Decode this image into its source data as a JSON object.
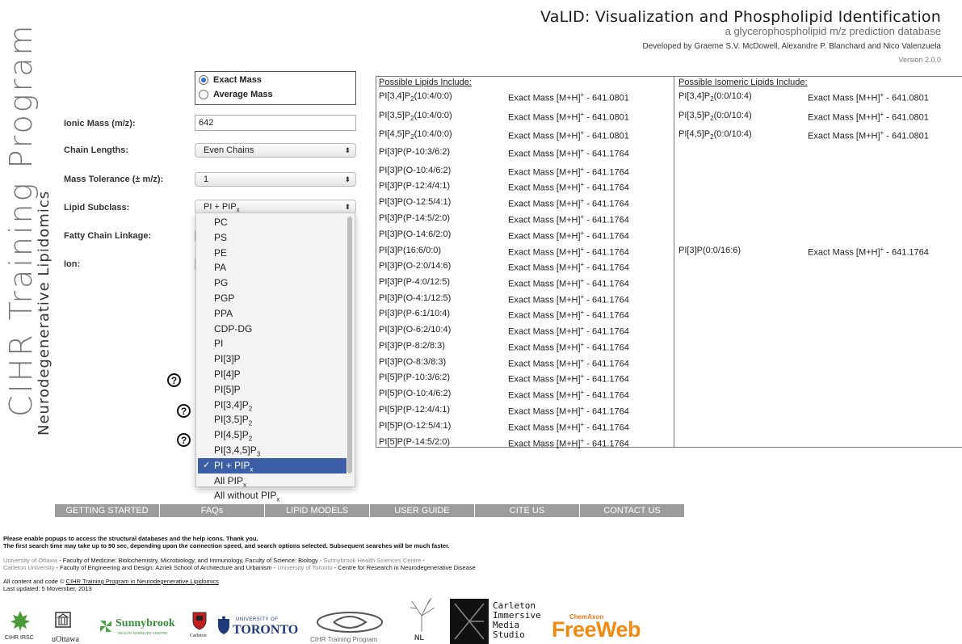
{
  "header": {
    "title": "VaLID: Visualization and Phospholipid Identification",
    "subtitle": "a glycerophospholipid m/z prediction database",
    "developers": "Developed by Graeme S.V. McDowell, Alexandre P. Blanchard and Nico Valenzuela",
    "version": "Version 2.0.0"
  },
  "branding": {
    "program": "CIHR Training Program",
    "field": "Neurodegenerative Lipidomics"
  },
  "form": {
    "mass_type": {
      "exact": "Exact Mass",
      "average": "Average Mass",
      "selected": "exact"
    },
    "ionic_mass_label": "Ionic Mass (m/z):",
    "ionic_mass_value": "642",
    "chain_lengths_label": "Chain Lengths:",
    "chain_lengths_value": "Even Chains",
    "tolerance_label": "Mass Tolerance (± m/z):",
    "tolerance_value": "1",
    "subclass_label": "Lipid Subclass:",
    "subclass_value_base": "PI + PIP",
    "subclass_value_sub": "x",
    "linkage_label": "Fatty Chain Linkage:",
    "ion_label": "Ion:"
  },
  "dropdown": {
    "options": [
      {
        "text": "PC",
        "sub": ""
      },
      {
        "text": "PS",
        "sub": ""
      },
      {
        "text": "PE",
        "sub": ""
      },
      {
        "text": "PA",
        "sub": ""
      },
      {
        "text": "PG",
        "sub": ""
      },
      {
        "text": "PGP",
        "sub": ""
      },
      {
        "text": "PPA",
        "sub": ""
      },
      {
        "text": "CDP-DG",
        "sub": ""
      },
      {
        "text": "PI",
        "sub": ""
      },
      {
        "text": "PI[3]P",
        "sub": ""
      },
      {
        "text": "PI[4]P",
        "sub": ""
      },
      {
        "text": "PI[5]P",
        "sub": ""
      },
      {
        "text": "PI[3,4]P",
        "sub": "2"
      },
      {
        "text": "PI[3,5]P",
        "sub": "2"
      },
      {
        "text": "PI[4,5]P",
        "sub": "2"
      },
      {
        "text": "PI[3,4,5]P",
        "sub": "3"
      },
      {
        "text": "PI + PIP",
        "sub": "x"
      },
      {
        "text": "All PIP",
        "sub": "x"
      },
      {
        "text": "All without PIP",
        "sub": "x"
      }
    ],
    "selected_index": 16,
    "check": "✓"
  },
  "help_icon": "?",
  "results": {
    "heading": "Possible Lipids Include:",
    "mass_prefix": "Exact Mass [M+H]",
    "mass_sup": "+",
    "rows": [
      {
        "pre": "PI[3,4]P",
        "sub": "2",
        "post": "(10:4/0:0)",
        "mass": " - 641.0801"
      },
      {
        "pre": "PI[3,5]P",
        "sub": "2",
        "post": "(10:4/0:0)",
        "mass": " - 641.0801"
      },
      {
        "pre": "PI[4,5]P",
        "sub": "2",
        "post": "(10:4/0:0)",
        "mass": " - 641.0801"
      },
      {
        "pre": "PI[3]P(P-10:3/6:2)",
        "sub": "",
        "post": "",
        "mass": " - 641.1764"
      },
      {
        "pre": "PI[3]P(O-10:4/6:2)",
        "sub": "",
        "post": "",
        "mass": " - 641.1764"
      },
      {
        "pre": "PI[3]P(P-12:4/4:1)",
        "sub": "",
        "post": "",
        "mass": " - 641.1764"
      },
      {
        "pre": "PI[3]P(O-12:5/4:1)",
        "sub": "",
        "post": "",
        "mass": " - 641.1764"
      },
      {
        "pre": "PI[3]P(P-14:5/2:0)",
        "sub": "",
        "post": "",
        "mass": " - 641.1764"
      },
      {
        "pre": "PI[3]P(O-14:6/2:0)",
        "sub": "",
        "post": "",
        "mass": " - 641.1764"
      },
      {
        "pre": "PI[3]P(16:6/0:0)",
        "sub": "",
        "post": "",
        "mass": " - 641.1764"
      },
      {
        "pre": "PI[3]P(O-2:0/14:6)",
        "sub": "",
        "post": "",
        "mass": " - 641.1764"
      },
      {
        "pre": "PI[3]P(P-4:0/12:5)",
        "sub": "",
        "post": "",
        "mass": " - 641.1764"
      },
      {
        "pre": "PI[3]P(O-4:1/12:5)",
        "sub": "",
        "post": "",
        "mass": " - 641.1764"
      },
      {
        "pre": "PI[3]P(P-6:1/10:4)",
        "sub": "",
        "post": "",
        "mass": " - 641.1764"
      },
      {
        "pre": "PI[3]P(O-6:2/10:4)",
        "sub": "",
        "post": "",
        "mass": " - 641.1764"
      },
      {
        "pre": "PI[3]P(P-8:2/8:3)",
        "sub": "",
        "post": "",
        "mass": " - 641.1764"
      },
      {
        "pre": "PI[3]P(O-8:3/8:3)",
        "sub": "",
        "post": "",
        "mass": " - 641.1764"
      },
      {
        "pre": "PI[5]P(P-10:3/6:2)",
        "sub": "",
        "post": "",
        "mass": " - 641.1764"
      },
      {
        "pre": "PI[5]P(O-10:4/6:2)",
        "sub": "",
        "post": "",
        "mass": " - 641.1764"
      },
      {
        "pre": "PI[5]P(P-12:4/4:1)",
        "sub": "",
        "post": "",
        "mass": " - 641.1764"
      },
      {
        "pre": "PI[5]P(O-12:5/4:1)",
        "sub": "",
        "post": "",
        "mass": " - 641.1764"
      },
      {
        "pre": "PI[5]P(P-14:5/2:0)",
        "sub": "",
        "post": "",
        "mass": " - 641.1764"
      }
    ]
  },
  "isomeric": {
    "heading": "Possible Isomeric Lipids Include:",
    "rows": [
      {
        "pre": "PI[3,4]P",
        "sub": "2",
        "post": "(0:0/10:4)",
        "mass": " - 641.0801",
        "slot": 0
      },
      {
        "pre": "PI[3,5]P",
        "sub": "2",
        "post": "(0:0/10:4)",
        "mass": " - 641.0801",
        "slot": 1
      },
      {
        "pre": "PI[4,5]P",
        "sub": "2",
        "post": "(0:0/10:4)",
        "mass": " - 641.0801",
        "slot": 2
      },
      {
        "pre": "PI[3]P(0:0/16:6)",
        "sub": "",
        "post": "",
        "mass": " - 641.1764",
        "slot": 9
      }
    ]
  },
  "nav": [
    "GETTING STARTED",
    "FAQs",
    "LIPID MODELS",
    "USER GUIDE",
    "CITE US",
    "CONTACT US"
  ],
  "footer": {
    "notice1": "Please enable popups to access the structural databases and the help icons. Thank you.",
    "notice2": "The first search time may take up to 90 sec, depending upon the connection speed, and search options selected. Subsequent searches will be much faster.",
    "aff1a": "University of Ottawa",
    "aff1b": " - Faculty of Medicine: Biolochemistry, Microbiology, and Immunology, Faculty of Science: Biology - ",
    "aff1c": "Sunnybrook Health Sciences Centre",
    "aff1d": " -",
    "aff2a": "Carleton University",
    "aff2b": " - Faculty of Engineering and Design: Azrieli School of Architecture and Urbanism - ",
    "aff2c": "University of Toronto",
    "aff2d": " - Centre for Research in Neurodegenerative Disease",
    "copy_prefix": "All content and code © ",
    "copy_link": "CIHR Training Program in Neurodegenerative Lipidomics",
    "updated": "Last updated: 5 Movember, 2013"
  },
  "logos": {
    "cihr": "CIHR IRSC",
    "uottawa": "uOttawa",
    "sunnybrook": "Sunnybrook",
    "sunnybrook_sub": "HEALTH SCIENCES CENTRE",
    "carleton": "Carleton",
    "toronto_small": "UNIVERSITY OF",
    "toronto": "TORONTO",
    "cihr_tp": "CIHR Training Program",
    "nl": "NL",
    "cims": [
      "Carleton",
      "Immersive",
      "Media",
      "Studio"
    ],
    "chemaxon": "ChemAxon",
    "freeweb": "FreeWeb"
  }
}
